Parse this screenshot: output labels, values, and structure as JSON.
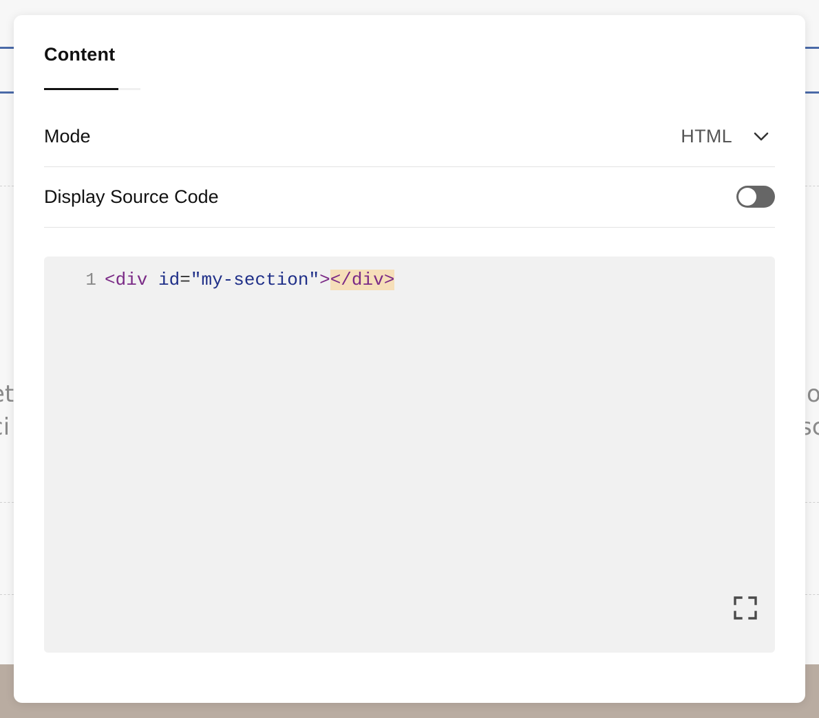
{
  "modal": {
    "tabs": [
      {
        "label": "Content",
        "active": true
      }
    ],
    "mode": {
      "label": "Mode",
      "value": "HTML"
    },
    "display_source_code": {
      "label": "Display Source Code",
      "enabled": false
    },
    "editor": {
      "line_number": "1",
      "tokens": {
        "open_tag": "<div",
        "attr_name": "id",
        "equals": "=",
        "attr_value": "\"my-section\"",
        "close_bracket": ">",
        "close_tag": "</div>"
      },
      "fullscreen_icon": "expand-icon"
    }
  },
  "background": {
    "left_text": [
      "et",
      "ci"
    ],
    "right_text": [
      "o",
      "sc"
    ]
  },
  "colors": {
    "accent_blue": "#4a6aa8",
    "toggle_off": "#666666",
    "bracket_match": "#f6dfb9",
    "editor_bg": "#f1f1f1",
    "footer_bg": "#b9aca1"
  }
}
